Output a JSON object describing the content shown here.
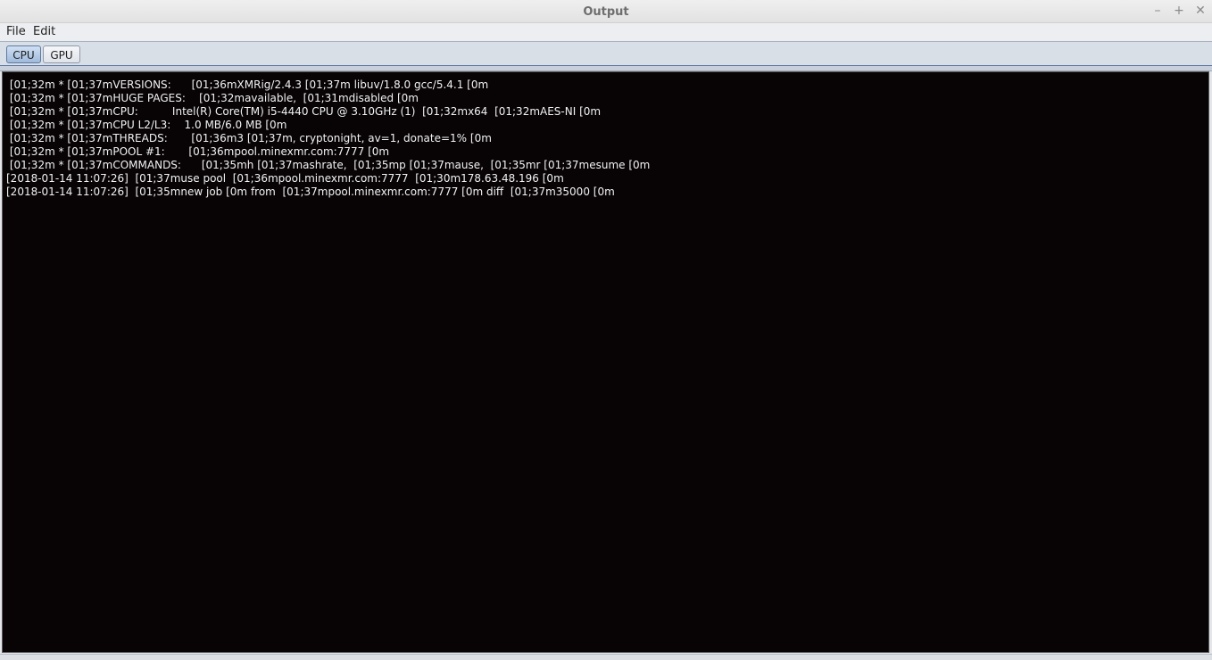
{
  "window": {
    "title": "Output"
  },
  "controls": {
    "minimize": "–",
    "maximize": "+",
    "close": "✕"
  },
  "menubar": {
    "file": "File",
    "edit": "Edit"
  },
  "tabs": [
    {
      "label": "CPU",
      "active": true
    },
    {
      "label": "GPU",
      "active": false
    }
  ],
  "console": {
    "background": "#080405",
    "foreground": "#f2f2f2",
    "lines": [
      " [01;32m * [01;37mVERSIONS:      [01;36mXMRig/2.4.3 [01;37m libuv/1.8.0 gcc/5.4.1 [0m",
      " [01;32m * [01;37mHUGE PAGES:    [01;32mavailable,  [01;31mdisabled [0m",
      " [01;32m * [01;37mCPU:          Intel(R) Core(TM) i5-4440 CPU @ 3.10GHz (1)  [01;32mx64  [01;32mAES-NI [0m",
      " [01;32m * [01;37mCPU L2/L3:    1.0 MB/6.0 MB [0m",
      " [01;32m * [01;37mTHREADS:       [01;36m3 [01;37m, cryptonight, av=1, donate=1% [0m",
      " [01;32m * [01;37mPOOL #1:       [01;36mpool.minexmr.com:7777 [0m",
      " [01;32m * [01;37mCOMMANDS:      [01;35mh [01;37mashrate,  [01;35mp [01;37mause,  [01;35mr [01;37mesume [0m",
      "[2018-01-14 11:07:26]  [01;37muse pool  [01;36mpool.minexmr.com:7777  [01;30m178.63.48.196 [0m",
      "[2018-01-14 11:07:26]  [01;35mnew job [0m from  [01;37mpool.minexmr.com:7777 [0m diff  [01;37m35000 [0m"
    ]
  }
}
